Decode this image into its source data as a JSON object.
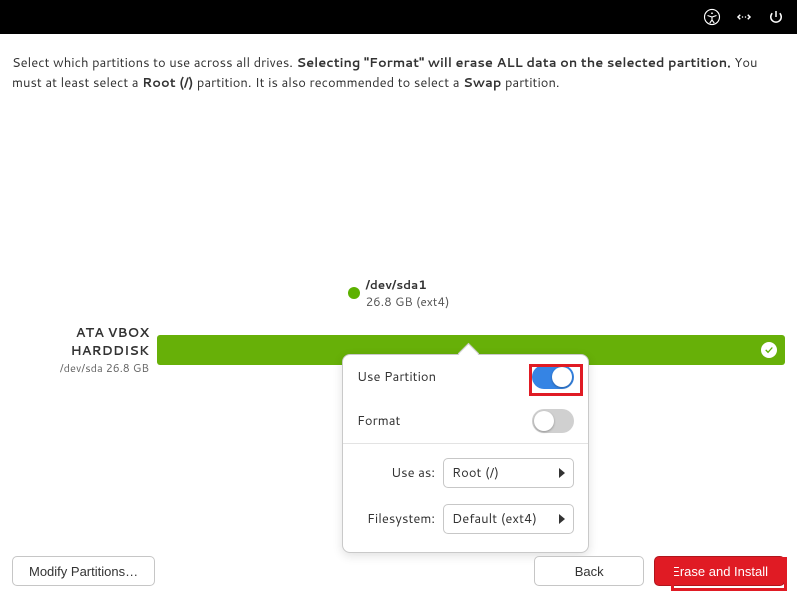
{
  "intro": {
    "p1": "Select which partitions to use across all drives. ",
    "bold1": "Selecting \"Format\" will erase ALL data on the selected partition.",
    "p2": " You must at least select a ",
    "bold2": "Root (/)",
    "p3": " partition. It is also recommended to select a ",
    "bold3": "Swap",
    "p4": " partition."
  },
  "legend": {
    "device": "/dev/sda1",
    "size": "26.8 GB (ext4)"
  },
  "disk": {
    "name": "ATA VBOX HARDDISK",
    "sub": "/dev/sda 26.8 GB"
  },
  "popover": {
    "use_partition_label": "Use Partition",
    "format_label": "Format",
    "use_as_label": "Use as:",
    "use_as_value": "Root (/)",
    "filesystem_label": "Filesystem:",
    "filesystem_value": "Default (ext4)"
  },
  "buttons": {
    "modify": "Modify Partitions…",
    "back": "Back",
    "erase": "Erase and Install"
  }
}
